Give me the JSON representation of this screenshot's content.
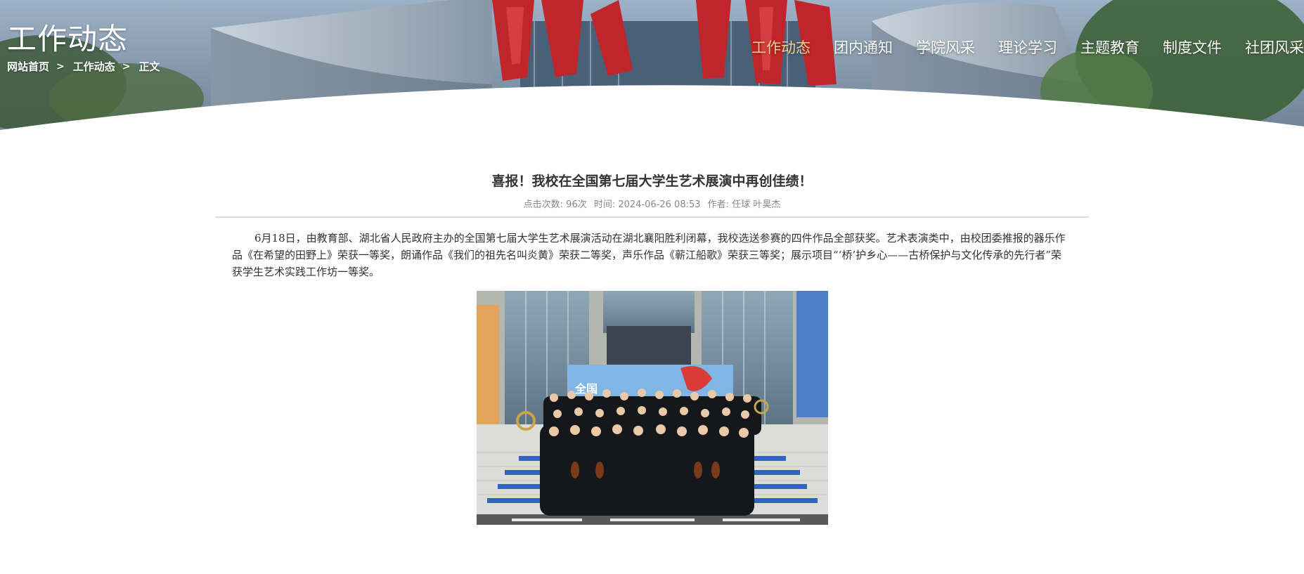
{
  "header": {
    "page_title": "工作动态",
    "breadcrumb": [
      {
        "label": "网站首页"
      },
      {
        "label": "工作动态"
      },
      {
        "label": "正文"
      }
    ],
    "breadcrumb_separator": ">",
    "nav": [
      {
        "label": "工作动态",
        "active": true
      },
      {
        "label": "团内通知",
        "active": false
      },
      {
        "label": "学院风采",
        "active": false
      },
      {
        "label": "理论学习",
        "active": false
      },
      {
        "label": "主题教育",
        "active": false
      },
      {
        "label": "制度文件",
        "active": false
      },
      {
        "label": "社团风采",
        "active": false
      }
    ],
    "active_nav_color": "#f3cf8c"
  },
  "article": {
    "title": "喜报！我校在全国第七届大学生艺术展演中再创佳绩！",
    "meta": {
      "clicks": "点击次数: 96次",
      "time": "时间: 2024-06-26 08:53",
      "author": "作者: 任球 叶昊杰"
    },
    "body": "6月18日，由教育部、湖北省人民政府主办的全国第七届大学生艺术展演活动在湖北襄阳胜利闭幕，我校选送参赛的四件作品全部获奖。艺术表演类中，由校团委推报的器乐作品《在希望的田野上》荣获一等奖，朗诵作品《我们的祖先名叫炎黄》荣获二等奖，声乐作品《蕲江船歌》荣获三等奖；展示项目“‘桥’护乡心——古桥保护与文化传承的先行者”荣获学生艺术实践工作坊一等奖。",
    "photo": {
      "icon": "group-photo-image",
      "backdrop_text": "全国"
    }
  }
}
